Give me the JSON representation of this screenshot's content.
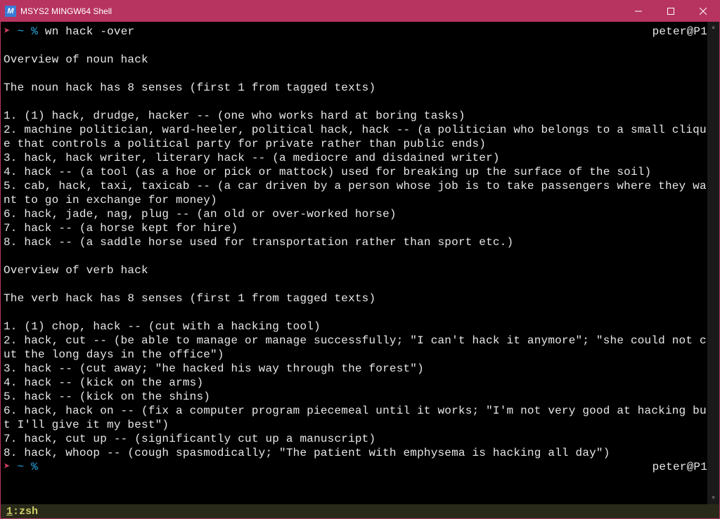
{
  "window": {
    "title": "MSYS2 MINGW64 Shell",
    "app_icon_letter": "M"
  },
  "prompt1": {
    "arrow": "➤",
    "path": "~",
    "sep": "%",
    "command": "wn hack -over",
    "user": "peter@P1"
  },
  "output": "\nOverview of noun hack\n\nThe noun hack has 8 senses (first 1 from tagged texts)\n\n1. (1) hack, drudge, hacker -- (one who works hard at boring tasks)\n2. machine politician, ward-heeler, political hack, hack -- (a politician who belongs to a small clique that controls a political party for private rather than public ends)\n3. hack, hack writer, literary hack -- (a mediocre and disdained writer)\n4. hack -- (a tool (as a hoe or pick or mattock) used for breaking up the surface of the soil)\n5. cab, hack, taxi, taxicab -- (a car driven by a person whose job is to take passengers where they want to go in exchange for money)\n6. hack, jade, nag, plug -- (an old or over-worked horse)\n7. hack -- (a horse kept for hire)\n8. hack -- (a saddle horse used for transportation rather than sport etc.)\n\nOverview of verb hack\n\nThe verb hack has 8 senses (first 1 from tagged texts)\n\n1. (1) chop, hack -- (cut with a hacking tool)\n2. hack, cut -- (be able to manage or manage successfully; \"I can't hack it anymore\"; \"she could not cut the long days in the office\")\n3. hack -- (cut away; \"he hacked his way through the forest\")\n4. hack -- (kick on the arms)\n5. hack -- (kick on the shins)\n6. hack, hack on -- (fix a computer program piecemeal until it works; \"I'm not very good at hacking but I'll give it my best\")\n7. hack, cut up -- (significantly cut up a manuscript)\n8. hack, whoop -- (cough spasmodically; \"The patient with emphysema is hacking all day\")",
  "prompt2": {
    "arrow": "➤",
    "path": "~",
    "sep": "%",
    "command": "",
    "user": "peter@P1"
  },
  "status": {
    "index": "1",
    "name": ":zsh"
  }
}
